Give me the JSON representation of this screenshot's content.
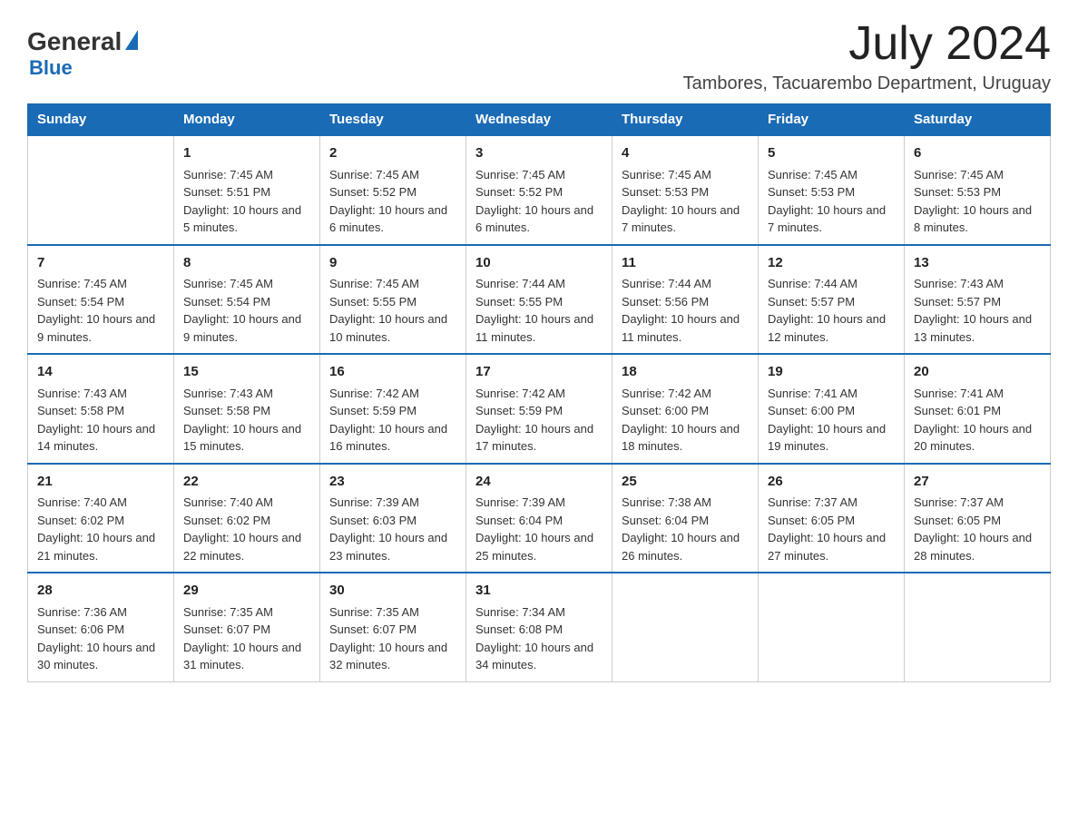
{
  "logo": {
    "general": "General",
    "blue": "Blue",
    "triangle_color": "#1a6bb5"
  },
  "title": {
    "month_year": "July 2024",
    "location": "Tambores, Tacuarembo Department, Uruguay"
  },
  "days_of_week": [
    "Sunday",
    "Monday",
    "Tuesday",
    "Wednesday",
    "Thursday",
    "Friday",
    "Saturday"
  ],
  "weeks": [
    [
      {
        "day": "",
        "sunrise": "",
        "sunset": "",
        "daylight": ""
      },
      {
        "day": "1",
        "sunrise": "Sunrise: 7:45 AM",
        "sunset": "Sunset: 5:51 PM",
        "daylight": "Daylight: 10 hours and 5 minutes."
      },
      {
        "day": "2",
        "sunrise": "Sunrise: 7:45 AM",
        "sunset": "Sunset: 5:52 PM",
        "daylight": "Daylight: 10 hours and 6 minutes."
      },
      {
        "day": "3",
        "sunrise": "Sunrise: 7:45 AM",
        "sunset": "Sunset: 5:52 PM",
        "daylight": "Daylight: 10 hours and 6 minutes."
      },
      {
        "day": "4",
        "sunrise": "Sunrise: 7:45 AM",
        "sunset": "Sunset: 5:53 PM",
        "daylight": "Daylight: 10 hours and 7 minutes."
      },
      {
        "day": "5",
        "sunrise": "Sunrise: 7:45 AM",
        "sunset": "Sunset: 5:53 PM",
        "daylight": "Daylight: 10 hours and 7 minutes."
      },
      {
        "day": "6",
        "sunrise": "Sunrise: 7:45 AM",
        "sunset": "Sunset: 5:53 PM",
        "daylight": "Daylight: 10 hours and 8 minutes."
      }
    ],
    [
      {
        "day": "7",
        "sunrise": "Sunrise: 7:45 AM",
        "sunset": "Sunset: 5:54 PM",
        "daylight": "Daylight: 10 hours and 9 minutes."
      },
      {
        "day": "8",
        "sunrise": "Sunrise: 7:45 AM",
        "sunset": "Sunset: 5:54 PM",
        "daylight": "Daylight: 10 hours and 9 minutes."
      },
      {
        "day": "9",
        "sunrise": "Sunrise: 7:45 AM",
        "sunset": "Sunset: 5:55 PM",
        "daylight": "Daylight: 10 hours and 10 minutes."
      },
      {
        "day": "10",
        "sunrise": "Sunrise: 7:44 AM",
        "sunset": "Sunset: 5:55 PM",
        "daylight": "Daylight: 10 hours and 11 minutes."
      },
      {
        "day": "11",
        "sunrise": "Sunrise: 7:44 AM",
        "sunset": "Sunset: 5:56 PM",
        "daylight": "Daylight: 10 hours and 11 minutes."
      },
      {
        "day": "12",
        "sunrise": "Sunrise: 7:44 AM",
        "sunset": "Sunset: 5:57 PM",
        "daylight": "Daylight: 10 hours and 12 minutes."
      },
      {
        "day": "13",
        "sunrise": "Sunrise: 7:43 AM",
        "sunset": "Sunset: 5:57 PM",
        "daylight": "Daylight: 10 hours and 13 minutes."
      }
    ],
    [
      {
        "day": "14",
        "sunrise": "Sunrise: 7:43 AM",
        "sunset": "Sunset: 5:58 PM",
        "daylight": "Daylight: 10 hours and 14 minutes."
      },
      {
        "day": "15",
        "sunrise": "Sunrise: 7:43 AM",
        "sunset": "Sunset: 5:58 PM",
        "daylight": "Daylight: 10 hours and 15 minutes."
      },
      {
        "day": "16",
        "sunrise": "Sunrise: 7:42 AM",
        "sunset": "Sunset: 5:59 PM",
        "daylight": "Daylight: 10 hours and 16 minutes."
      },
      {
        "day": "17",
        "sunrise": "Sunrise: 7:42 AM",
        "sunset": "Sunset: 5:59 PM",
        "daylight": "Daylight: 10 hours and 17 minutes."
      },
      {
        "day": "18",
        "sunrise": "Sunrise: 7:42 AM",
        "sunset": "Sunset: 6:00 PM",
        "daylight": "Daylight: 10 hours and 18 minutes."
      },
      {
        "day": "19",
        "sunrise": "Sunrise: 7:41 AM",
        "sunset": "Sunset: 6:00 PM",
        "daylight": "Daylight: 10 hours and 19 minutes."
      },
      {
        "day": "20",
        "sunrise": "Sunrise: 7:41 AM",
        "sunset": "Sunset: 6:01 PM",
        "daylight": "Daylight: 10 hours and 20 minutes."
      }
    ],
    [
      {
        "day": "21",
        "sunrise": "Sunrise: 7:40 AM",
        "sunset": "Sunset: 6:02 PM",
        "daylight": "Daylight: 10 hours and 21 minutes."
      },
      {
        "day": "22",
        "sunrise": "Sunrise: 7:40 AM",
        "sunset": "Sunset: 6:02 PM",
        "daylight": "Daylight: 10 hours and 22 minutes."
      },
      {
        "day": "23",
        "sunrise": "Sunrise: 7:39 AM",
        "sunset": "Sunset: 6:03 PM",
        "daylight": "Daylight: 10 hours and 23 minutes."
      },
      {
        "day": "24",
        "sunrise": "Sunrise: 7:39 AM",
        "sunset": "Sunset: 6:04 PM",
        "daylight": "Daylight: 10 hours and 25 minutes."
      },
      {
        "day": "25",
        "sunrise": "Sunrise: 7:38 AM",
        "sunset": "Sunset: 6:04 PM",
        "daylight": "Daylight: 10 hours and 26 minutes."
      },
      {
        "day": "26",
        "sunrise": "Sunrise: 7:37 AM",
        "sunset": "Sunset: 6:05 PM",
        "daylight": "Daylight: 10 hours and 27 minutes."
      },
      {
        "day": "27",
        "sunrise": "Sunrise: 7:37 AM",
        "sunset": "Sunset: 6:05 PM",
        "daylight": "Daylight: 10 hours and 28 minutes."
      }
    ],
    [
      {
        "day": "28",
        "sunrise": "Sunrise: 7:36 AM",
        "sunset": "Sunset: 6:06 PM",
        "daylight": "Daylight: 10 hours and 30 minutes."
      },
      {
        "day": "29",
        "sunrise": "Sunrise: 7:35 AM",
        "sunset": "Sunset: 6:07 PM",
        "daylight": "Daylight: 10 hours and 31 minutes."
      },
      {
        "day": "30",
        "sunrise": "Sunrise: 7:35 AM",
        "sunset": "Sunset: 6:07 PM",
        "daylight": "Daylight: 10 hours and 32 minutes."
      },
      {
        "day": "31",
        "sunrise": "Sunrise: 7:34 AM",
        "sunset": "Sunset: 6:08 PM",
        "daylight": "Daylight: 10 hours and 34 minutes."
      },
      {
        "day": "",
        "sunrise": "",
        "sunset": "",
        "daylight": ""
      },
      {
        "day": "",
        "sunrise": "",
        "sunset": "",
        "daylight": ""
      },
      {
        "day": "",
        "sunrise": "",
        "sunset": "",
        "daylight": ""
      }
    ]
  ]
}
